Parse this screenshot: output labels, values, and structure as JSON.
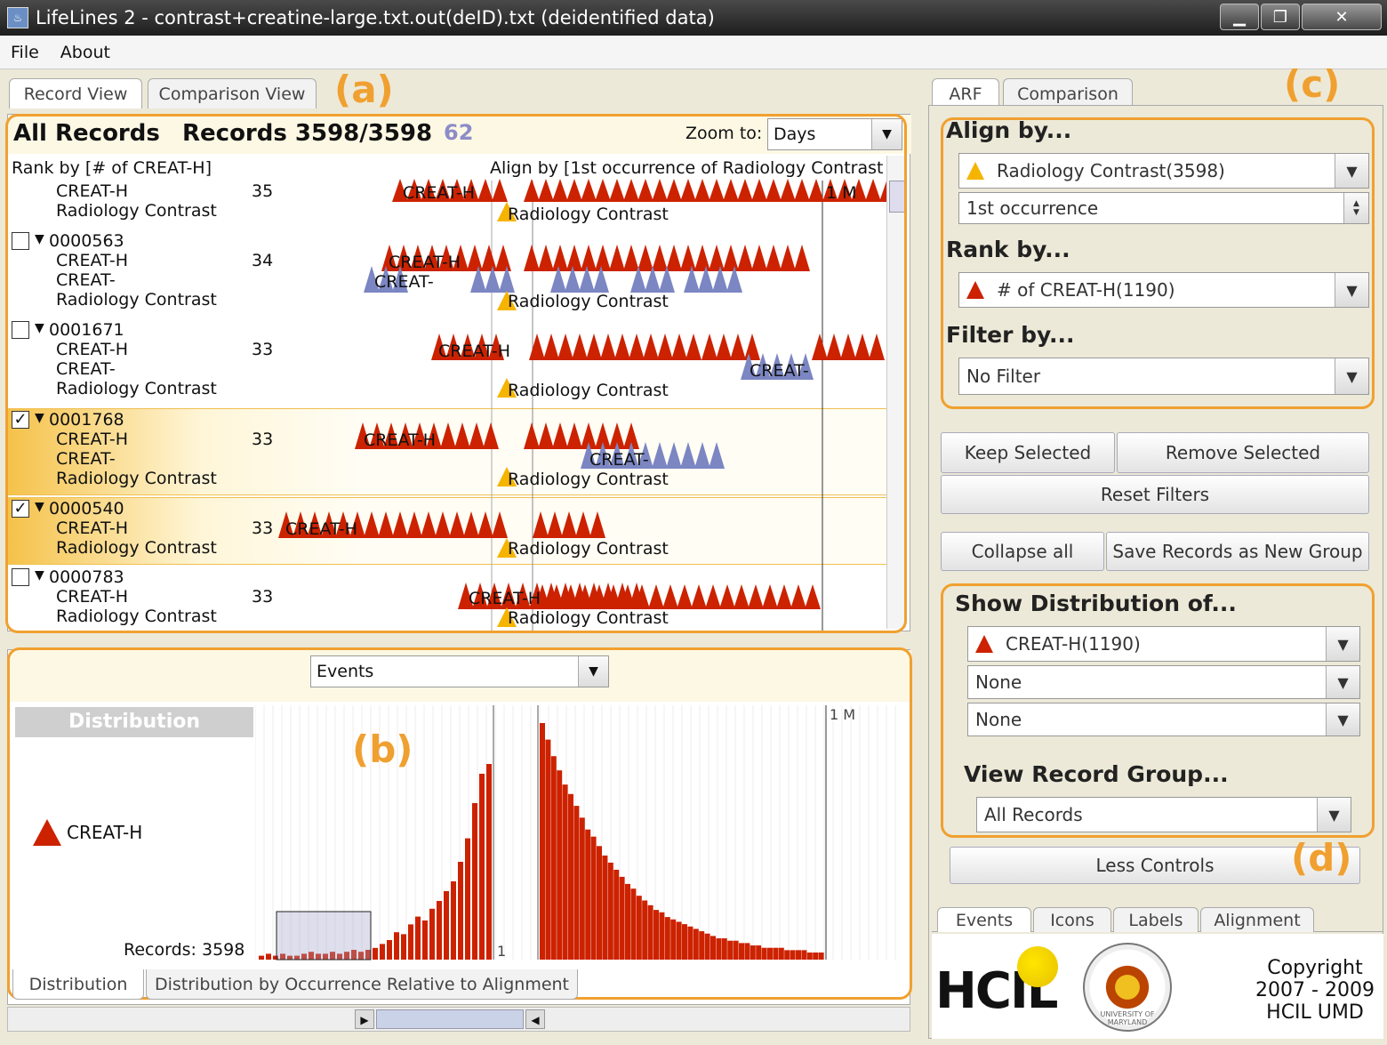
{
  "window": {
    "title": "LifeLines 2 - contrast+creatine-large.txt.out(deID).txt (deidentified data)"
  },
  "menu": [
    "File",
    "About"
  ],
  "left_tabs": [
    "Record View",
    "Comparison View"
  ],
  "right_tabs": [
    "ARF",
    "Comparison"
  ],
  "callouts": {
    "a": "(a)",
    "b": "(b)",
    "c": "(c)",
    "d": "(d)"
  },
  "records": {
    "title": "All Records",
    "count": "Records 3598/3598",
    "badge": "62",
    "zoom_label": "Zoom to:",
    "zoom_value": "Days",
    "rank_header": "Rank by [# of CREAT-H]",
    "align_header": "Align by  [1st occurrence of Radiology Contrast]",
    "month_marker": "1 M",
    "rows": [
      {
        "id": "",
        "lines": [
          "CREAT-H",
          "Radiology Contrast"
        ],
        "rank": "35",
        "checked": false
      },
      {
        "id": "0000563",
        "lines": [
          "CREAT-H",
          "CREAT-",
          "Radiology Contrast"
        ],
        "rank": "34",
        "checked": false
      },
      {
        "id": "0001671",
        "lines": [
          "CREAT-H",
          "CREAT-",
          "Radiology Contrast"
        ],
        "rank": "33",
        "checked": false
      },
      {
        "id": "0001768",
        "lines": [
          "CREAT-H",
          "CREAT-",
          "Radiology Contrast"
        ],
        "rank": "33",
        "checked": true
      },
      {
        "id": "0000540",
        "lines": [
          "CREAT-H",
          "Radiology Contrast"
        ],
        "rank": "33",
        "checked": true
      },
      {
        "id": "0000783",
        "lines": [
          "CREAT-H",
          "Radiology Contrast"
        ],
        "rank": "33",
        "checked": false
      }
    ],
    "event_labels": {
      "creat_h": "CREAT-H",
      "creat": "CREAT-",
      "contrast": "Radiology Contrast"
    }
  },
  "distribution": {
    "events_combo": "Events",
    "title": "Distribution",
    "legend": "CREAT-H",
    "records_label": "Records: 3598",
    "month_marker": "1 M",
    "zero_marker": "1",
    "tabs": [
      "Distribution",
      "Distribution by Occurrence Relative to Alignment"
    ]
  },
  "controls": {
    "align_by": {
      "heading": "Align by...",
      "value": "Radiology Contrast(3598)",
      "occurrence": "1st occurrence"
    },
    "rank_by": {
      "heading": "Rank by...",
      "value": "# of CREAT-H(1190)"
    },
    "filter_by": {
      "heading": "Filter by...",
      "value": "No Filter"
    },
    "buttons": {
      "keep": "Keep Selected",
      "remove": "Remove Selected",
      "reset": "Reset Filters",
      "collapse": "Collapse all",
      "save": "Save Records as New Group",
      "less": "Less Controls"
    },
    "show_dist": {
      "heading": "Show Distribution of...",
      "v1": "CREAT-H(1190)",
      "v2": "None",
      "v3": "None"
    },
    "view_group": {
      "heading": "View Record Group...",
      "value": "All Records"
    },
    "bottom_tabs": [
      "Events",
      "Icons",
      "Labels",
      "Alignment"
    ]
  },
  "logo": {
    "hcil": "HCIL",
    "copyright": "Copyright",
    "years": "2007 - 2009",
    "org": "HCIL  UMD",
    "seal": "UNIVERSITY OF MARYLAND"
  },
  "colors": {
    "creat_h": "#cc2200",
    "creat": "#7b86c2",
    "contrast": "#f5b400",
    "accent": "#f0a030"
  },
  "distribution_bars": [
    2,
    3,
    2,
    3,
    2,
    2,
    3,
    4,
    3,
    3,
    4,
    3,
    4,
    5,
    4,
    5,
    6,
    8,
    10,
    14,
    13,
    18,
    22,
    20,
    26,
    30,
    35,
    40,
    50,
    62,
    80,
    95,
    100
  ],
  "distribution_bars_after": [
    100,
    93,
    86,
    80,
    74,
    70,
    65,
    60,
    55,
    52,
    48,
    44,
    41,
    38,
    35,
    32,
    30,
    27,
    25,
    23,
    21,
    20,
    18,
    17,
    16,
    15,
    14,
    13,
    12,
    11,
    10,
    9,
    9,
    8,
    8,
    7,
    7,
    6,
    6,
    5,
    5,
    5,
    5,
    4,
    4,
    4,
    4,
    3,
    3,
    3
  ]
}
